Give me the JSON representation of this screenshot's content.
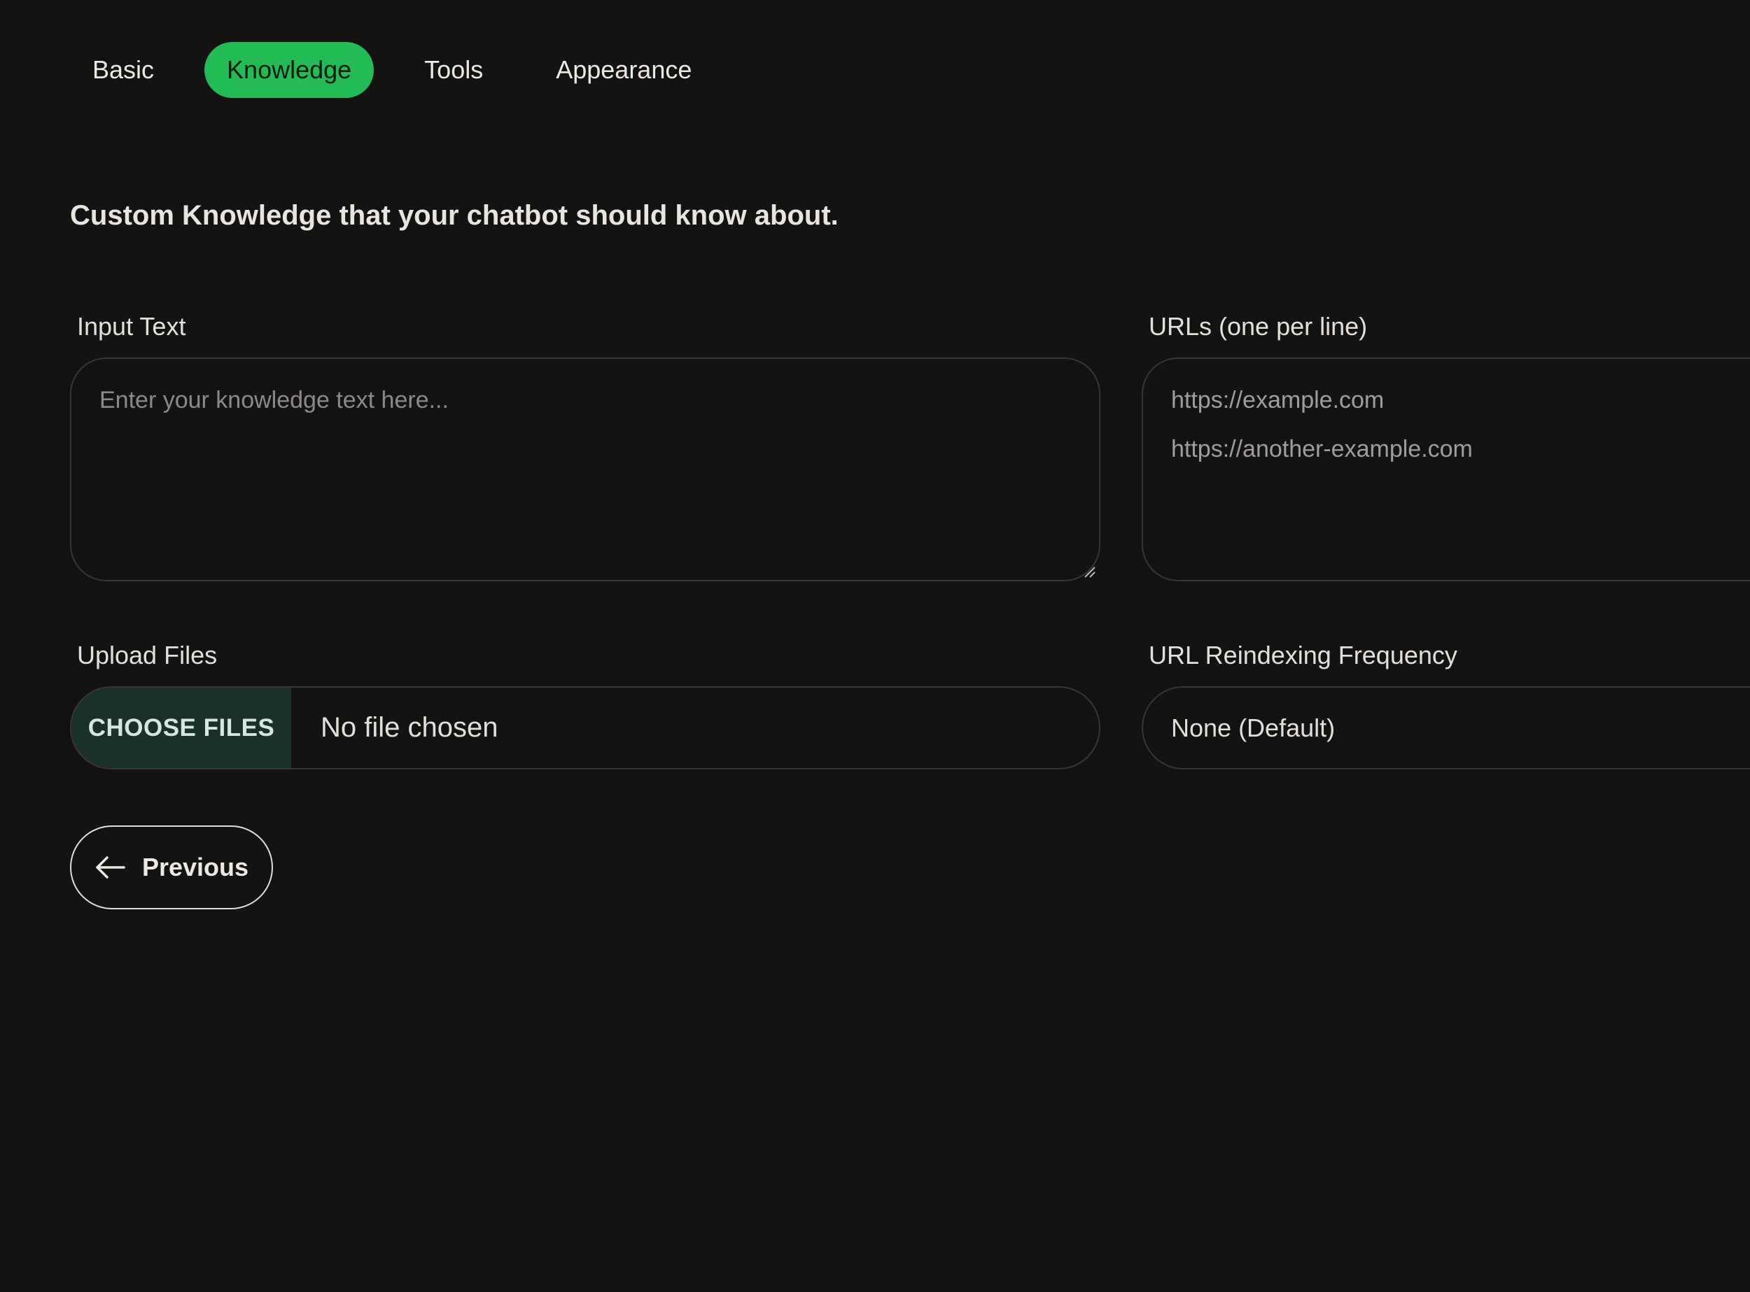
{
  "tabs": [
    {
      "label": "Basic",
      "active": false
    },
    {
      "label": "Knowledge",
      "active": true
    },
    {
      "label": "Tools",
      "active": false
    },
    {
      "label": "Appearance",
      "active": false
    }
  ],
  "heading": "Custom Knowledge that your chatbot should know about.",
  "input_text": {
    "label": "Input Text",
    "placeholder": "Enter your knowledge text here..."
  },
  "urls": {
    "label": "URLs (one per line)",
    "lines": [
      "https://example.com",
      "https://another-example.com"
    ]
  },
  "upload": {
    "label": "Upload Files",
    "button_label": "CHOOSE FILES",
    "status": "No file chosen"
  },
  "reindex": {
    "label": "URL Reindexing Frequency",
    "selected": "None (Default)"
  },
  "previous_button": {
    "label": "Previous",
    "icon": "arrow-left-icon"
  },
  "colors": {
    "background": "#151212",
    "accent": "#22bb55",
    "choose_files_bg": "#1a302a",
    "border": "#3a3634"
  }
}
